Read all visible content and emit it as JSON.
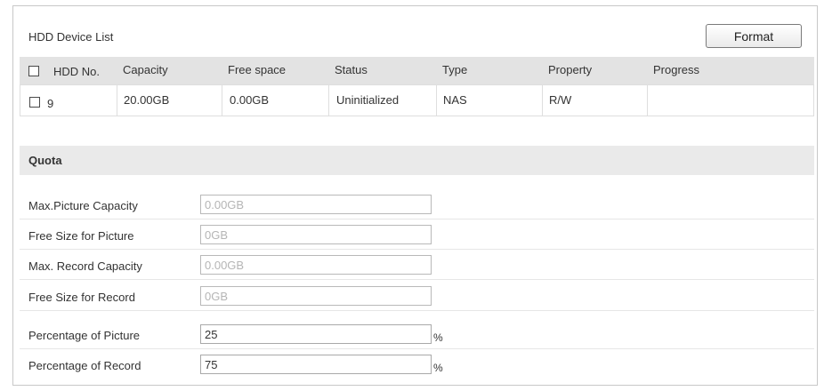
{
  "hdd_section": {
    "title": "HDD Device List",
    "format_label": "Format",
    "columns": [
      "HDD No.",
      "Capacity",
      "Free space",
      "Status",
      "Type",
      "Property",
      "Progress"
    ],
    "rows": [
      {
        "hdd_no": "9",
        "capacity": "20.00GB",
        "free_space": "0.00GB",
        "status": "Uninitialized",
        "type": "NAS",
        "property": "R/W",
        "progress": ""
      }
    ]
  },
  "quota": {
    "title": "Quota",
    "fields": [
      {
        "label": "Max.Picture Capacity",
        "value": "0.00GB",
        "editable": false,
        "unit": ""
      },
      {
        "label": "Free Size for Picture",
        "value": "0GB",
        "editable": false,
        "unit": ""
      },
      {
        "label": "Max. Record Capacity",
        "value": "0.00GB",
        "editable": false,
        "unit": ""
      },
      {
        "label": "Free Size for Record",
        "value": "0GB",
        "editable": false,
        "unit": ""
      },
      {
        "label": "Percentage of Picture",
        "value": "25",
        "editable": true,
        "unit": "%"
      },
      {
        "label": "Percentage of Record",
        "value": "75",
        "editable": true,
        "unit": "%"
      }
    ]
  }
}
